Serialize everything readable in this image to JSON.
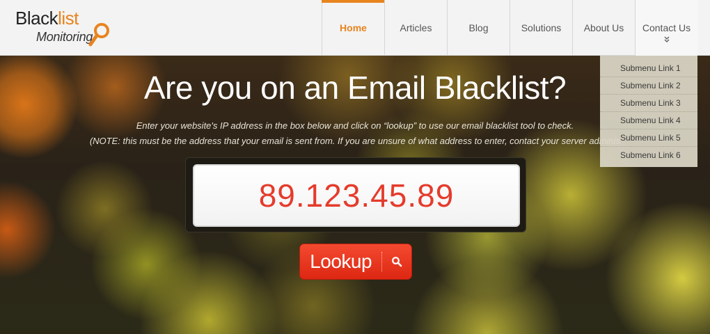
{
  "brand": {
    "name_part1": "Black",
    "name_part2": "list",
    "subtitle": "Monitoring",
    "accent_color": "#e8841e"
  },
  "nav": {
    "items": [
      {
        "label": "Home",
        "active": true
      },
      {
        "label": "Articles"
      },
      {
        "label": "Blog"
      },
      {
        "label": "Solutions"
      },
      {
        "label": "About Us"
      },
      {
        "label": "Contact Us",
        "has_submenu": true
      }
    ],
    "chevron_icon": "double-chevron-down-icon"
  },
  "submenu": {
    "items": [
      "Submenu Link 1",
      "Submenu Link 2",
      "Submenu Link 3",
      "Submenu Link 4",
      "Submenu Link 5",
      "Submenu Link 6"
    ]
  },
  "hero": {
    "title": "Are you on an Email Blacklist?",
    "desc_line1": "Enter your website's IP address in the box below and click on “lookup” to use our email blacklist tool to check.",
    "desc_line2": "(NOTE: this must be the address that your email is sent from. If you are unsure of what address to enter, contact your server adminis"
  },
  "lookup_form": {
    "ip_value": "89.123.45.89",
    "ip_color": "#e53b2c",
    "button_label": "Lookup",
    "button_icon": "search-icon",
    "button_color": "#e8311a"
  }
}
